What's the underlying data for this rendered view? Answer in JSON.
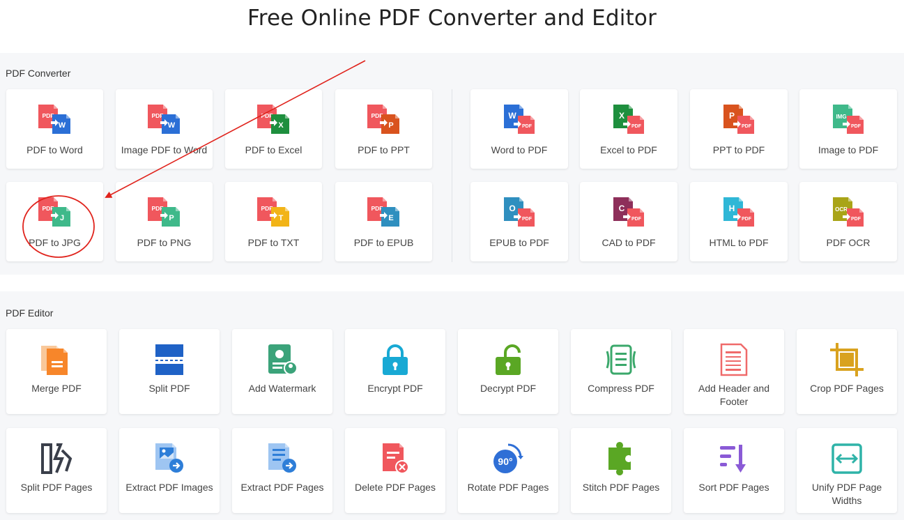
{
  "page": {
    "title": "Free Online PDF Converter and Editor"
  },
  "converter": {
    "label": "PDF Converter",
    "from_pdf": [
      {
        "label": "PDF to Word",
        "icon": "pdf-to-word-icon",
        "badge": "W",
        "color": "#2b6fd6"
      },
      {
        "label": "Image PDF to Word",
        "icon": "image-pdf-to-word-icon",
        "badge": "W",
        "color": "#2b6fd6"
      },
      {
        "label": "PDF to Excel",
        "icon": "pdf-to-excel-icon",
        "badge": "X",
        "color": "#1e8f3e"
      },
      {
        "label": "PDF to PPT",
        "icon": "pdf-to-ppt-icon",
        "badge": "P",
        "color": "#d9531e"
      },
      {
        "label": "PDF to JPG",
        "icon": "pdf-to-jpg-icon",
        "badge": "J",
        "color": "#3fb98a"
      },
      {
        "label": "PDF to PNG",
        "icon": "pdf-to-png-icon",
        "badge": "P",
        "color": "#3fb98a"
      },
      {
        "label": "PDF to TXT",
        "icon": "pdf-to-txt-icon",
        "badge": "T",
        "color": "#f2b417"
      },
      {
        "label": "PDF to EPUB",
        "icon": "pdf-to-epub-icon",
        "badge": "E",
        "color": "#2f8fbf"
      }
    ],
    "to_pdf": [
      {
        "label": "Word to PDF",
        "icon": "word-to-pdf-icon",
        "badge": "W",
        "color": "#2b6fd6"
      },
      {
        "label": "Excel to PDF",
        "icon": "excel-to-pdf-icon",
        "badge": "X",
        "color": "#1e8f3e"
      },
      {
        "label": "PPT to PDF",
        "icon": "ppt-to-pdf-icon",
        "badge": "P",
        "color": "#d9531e"
      },
      {
        "label": "Image to PDF",
        "icon": "image-to-pdf-icon",
        "badge": "IMG",
        "color": "#3fb98a"
      },
      {
        "label": "EPUB to PDF",
        "icon": "epub-to-pdf-icon",
        "badge": "O",
        "color": "#2f8fbf"
      },
      {
        "label": "CAD to PDF",
        "icon": "cad-to-pdf-icon",
        "badge": "C",
        "color": "#8e2f5a"
      },
      {
        "label": "HTML to PDF",
        "icon": "html-to-pdf-icon",
        "badge": "H",
        "color": "#2fb7d6"
      },
      {
        "label": "PDF OCR",
        "icon": "pdf-ocr-icon",
        "badge": "OCR",
        "color": "#a9a417"
      }
    ],
    "pdf_tag": "PDF",
    "pdf_color": "#f0575d"
  },
  "editor": {
    "label": "PDF Editor",
    "tools": [
      {
        "label": "Merge PDF",
        "icon": "merge-pdf-icon",
        "color": "#f7862a"
      },
      {
        "label": "Split PDF",
        "icon": "split-pdf-icon",
        "color": "#1f62c6"
      },
      {
        "label": "Add Watermark",
        "icon": "add-watermark-icon",
        "color": "#3ba37a"
      },
      {
        "label": "Encrypt PDF",
        "icon": "encrypt-pdf-icon",
        "color": "#18a9d4"
      },
      {
        "label": "Decrypt PDF",
        "icon": "decrypt-pdf-icon",
        "color": "#5aa724"
      },
      {
        "label": "Compress PDF",
        "icon": "compress-pdf-icon",
        "color": "#3ba86b"
      },
      {
        "label": "Add Header and Footer",
        "icon": "header-footer-icon",
        "color": "#ef6a6a"
      },
      {
        "label": "Crop PDF Pages",
        "icon": "crop-pdf-icon",
        "color": "#d9a21f"
      },
      {
        "label": "Split PDF Pages",
        "icon": "split-pdf-pages-icon",
        "color": "#3a3f4a"
      },
      {
        "label": "Extract PDF Images",
        "icon": "extract-images-icon",
        "color": "#2e7ed8"
      },
      {
        "label": "Extract PDF Pages",
        "icon": "extract-pages-icon",
        "color": "#2e7ed8"
      },
      {
        "label": "Delete PDF Pages",
        "icon": "delete-pages-icon",
        "color": "#f0575d"
      },
      {
        "label": "Rotate PDF Pages",
        "icon": "rotate-pages-icon",
        "color": "#2f6fd6",
        "badge": "90°"
      },
      {
        "label": "Stitch PDF Pages",
        "icon": "stitch-pages-icon",
        "color": "#5aa724"
      },
      {
        "label": "Sort PDF Pages",
        "icon": "sort-pages-icon",
        "color": "#8a5ad6"
      },
      {
        "label": "Unify PDF Page Widths",
        "icon": "unify-widths-icon",
        "color": "#2fb3a8"
      }
    ]
  },
  "annotation": {
    "color": "#e0231c"
  }
}
